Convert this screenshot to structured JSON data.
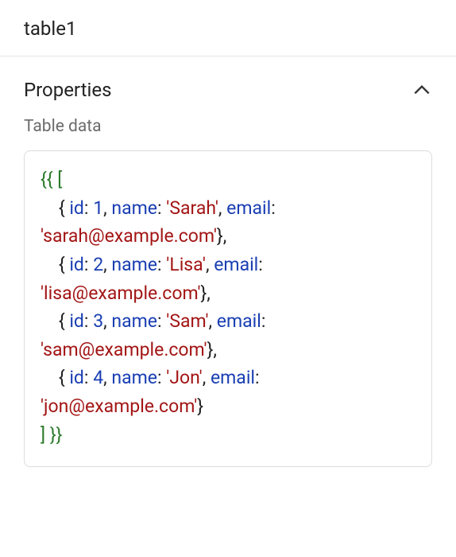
{
  "header": {
    "title": "table1"
  },
  "section": {
    "title": "Properties",
    "expanded": true,
    "field_label": "Table data"
  },
  "code": {
    "open_expr": "{{",
    "close_expr": "}}",
    "open_arr": "[",
    "close_arr": "]",
    "key_id": "id",
    "key_name": "name",
    "key_email": "email",
    "colon": ":",
    "comma": ",",
    "obrace": "{",
    "cbrace": "}",
    "rows": [
      {
        "id": "1",
        "name": "'Sarah'",
        "email": "'sarah@example.com'"
      },
      {
        "id": "2",
        "name": "'Lisa'",
        "email": "'lisa@example.com'"
      },
      {
        "id": "3",
        "name": "'Sam'",
        "email": "'sam@example.com'"
      },
      {
        "id": "4",
        "name": "'Jon'",
        "email": "'jon@example.com'"
      }
    ]
  }
}
